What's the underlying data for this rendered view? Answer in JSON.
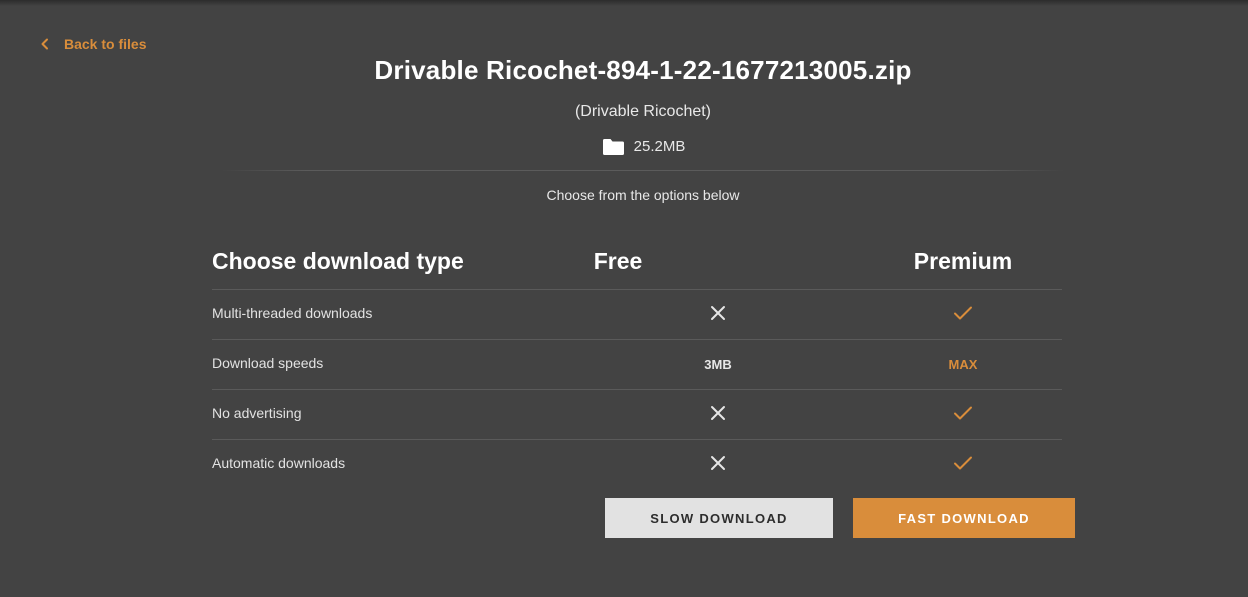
{
  "nav": {
    "back_label": "Back to files"
  },
  "file": {
    "name": "Drivable Ricochet-894-1-22-1677213005.zip",
    "mod_name": "(Drivable Ricochet)",
    "size": "25.2MB"
  },
  "hint": "Choose from the options below",
  "table": {
    "header": {
      "type": "Choose download type",
      "free": "Free",
      "premium": "Premium"
    },
    "rows": [
      {
        "label": "Multi-threaded downloads",
        "free": {
          "kind": "icon",
          "icon": "x-icon"
        },
        "premium": {
          "kind": "icon",
          "icon": "check-icon"
        }
      },
      {
        "label": "Download speeds",
        "free": {
          "kind": "text",
          "text": "3MB"
        },
        "premium": {
          "kind": "text",
          "text": "MAX"
        }
      },
      {
        "label": "No advertising",
        "free": {
          "kind": "icon",
          "icon": "x-icon"
        },
        "premium": {
          "kind": "icon",
          "icon": "check-icon"
        }
      },
      {
        "label": "Automatic downloads",
        "free": {
          "kind": "icon",
          "icon": "x-icon"
        },
        "premium": {
          "kind": "icon",
          "icon": "check-icon"
        }
      }
    ]
  },
  "buttons": {
    "slow": "SLOW DOWNLOAD",
    "fast": "FAST DOWNLOAD"
  },
  "colors": {
    "background": "#434343",
    "accent": "#d98d3b",
    "slow_button": "#e2e2e2",
    "text": "#ffffff"
  }
}
